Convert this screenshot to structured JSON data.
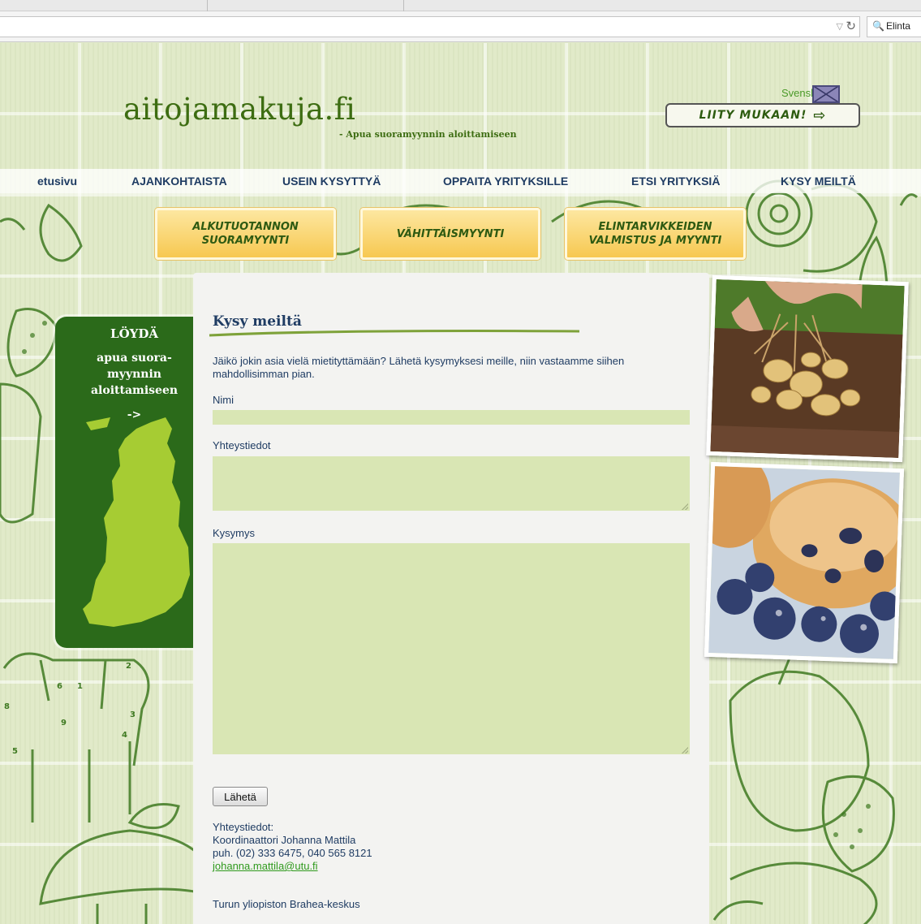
{
  "browser": {
    "search_text": "Elinta"
  },
  "header": {
    "logo": "aitojamakuja.fi",
    "tagline": "- Apua suoramyynnin aloittamiseen",
    "language_link": "Svenska",
    "join_label": "LIITY MUKAAN!"
  },
  "nav": {
    "items": [
      {
        "label": "etusivu"
      },
      {
        "label": "AJANKOHTAISTA"
      },
      {
        "label": "USEIN KYSYTTYÄ"
      },
      {
        "label": "OPPAITA YRITYKSILLE"
      },
      {
        "label": "ETSI YRITYKSIÄ"
      },
      {
        "label": "KYSY MEILTÄ"
      }
    ]
  },
  "categories": [
    {
      "line1": "ALKUTUOTANNON",
      "line2": "SUORAMYYNTI"
    },
    {
      "line1": "VÄHITTÄISMYYNTI",
      "line2": ""
    },
    {
      "line1": "ELINTARVIKKEIDEN",
      "line2": "VALMISTUS JA MYYNTI"
    }
  ],
  "sidebar": {
    "title": "LÖYDÄ",
    "line1": "apua suora-",
    "line2": "myynnin",
    "line3": "aloittamiseen",
    "arrow": "->"
  },
  "form": {
    "heading": "Kysy meiltä",
    "intro": "Jäikö jokin asia vielä mietityttämään? Lähetä kysymyksesi meille, niin vastaamme siihen mahdollisimman pian.",
    "name_label": "Nimi",
    "name_value": "",
    "contact_label": "Yhteystiedot",
    "contact_value": "",
    "question_label": "Kysymys",
    "question_value": "",
    "submit_label": "Lähetä"
  },
  "footer": {
    "contact_heading": "Yhteystiedot:",
    "coordinator": "Koordinaattori Johanna Mattila",
    "phone": "puh. (02) 333 6475, 040 565 8121",
    "email": "johanna.mattila@utu.fi",
    "organization": "Turun yliopiston Brahea-keskus"
  },
  "colors": {
    "brand_green": "#3d6d12",
    "nav_text": "#1f3c63",
    "field_bg": "#d9e6b4",
    "sidebar_green": "#2b6a1a",
    "button_yellow": "#f7c851"
  }
}
